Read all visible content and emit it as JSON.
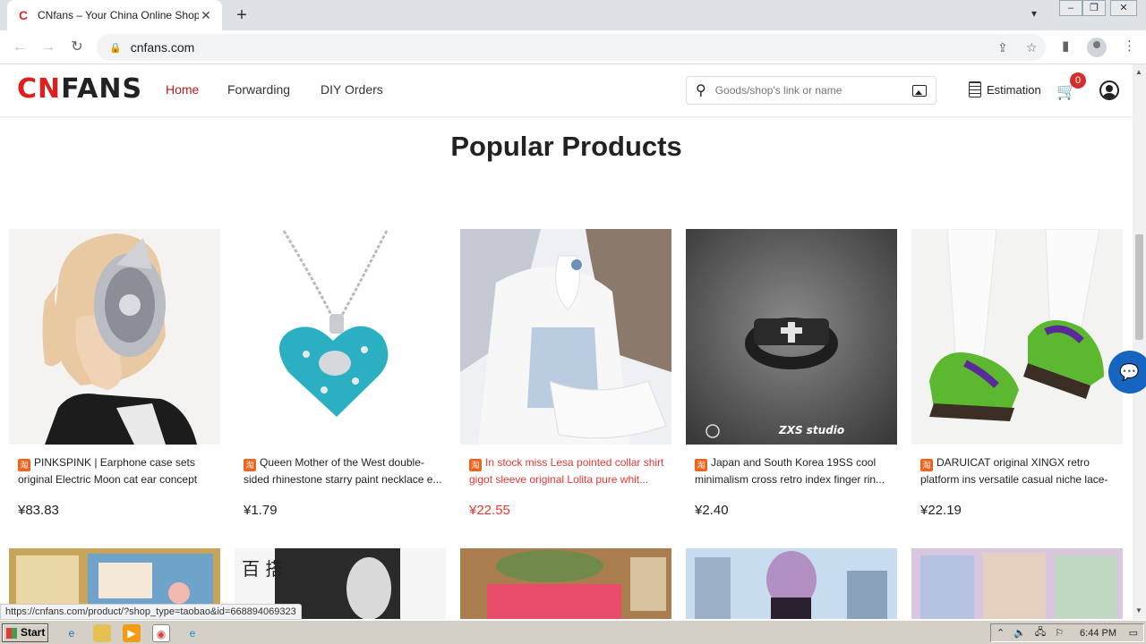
{
  "browser": {
    "tab_title": "CNfans – Your China Online Shopping",
    "tab_favicon": "C",
    "tab_close": "✕",
    "new_tab": "+",
    "url": "cnfans.com",
    "status_url": "https://cnfans.com/product/?shop_type=taobao&id=668894069323"
  },
  "site": {
    "logo_main": "CN",
    "logo_rest": "FANS",
    "nav": [
      {
        "label": "Home",
        "active": true
      },
      {
        "label": "Forwarding",
        "active": false
      },
      {
        "label": "DIY Orders",
        "active": false
      }
    ],
    "search_placeholder": "Goods/shop's link or name",
    "estimation_label": "Estimation",
    "cart_count": "0",
    "accent_color": "#d32f2f",
    "link_red": "#e53935"
  },
  "main": {
    "section_title": "Popular Products",
    "source_badge": "淘",
    "products": [
      {
        "name": "PINKSPINK | Earphone case sets original Electric Moon cat ear concept sp...",
        "price": "¥83.83",
        "highlighted": false
      },
      {
        "name": "Queen Mother of the West double-sided rhinestone starry paint necklace e...",
        "price": "¥1.79",
        "highlighted": false
      },
      {
        "name": "In stock miss Lesa pointed collar shirt gigot sleeve original Lolita pure whit...",
        "price": "¥22.55",
        "highlighted": true
      },
      {
        "name": "Japan and South Korea 19SS cool minimalism cross retro index finger rin...",
        "price": "¥2.40",
        "highlighted": false
      },
      {
        "name": "DARUICAT original XINGX retro platform ins versatile casual niche lace-up ...",
        "price": "¥22.19",
        "highlighted": false
      }
    ],
    "ring_caption": "ZXS studio",
    "row2_text": "百 搭"
  },
  "taskbar": {
    "start_label": "Start",
    "clock": "6:44 PM"
  }
}
